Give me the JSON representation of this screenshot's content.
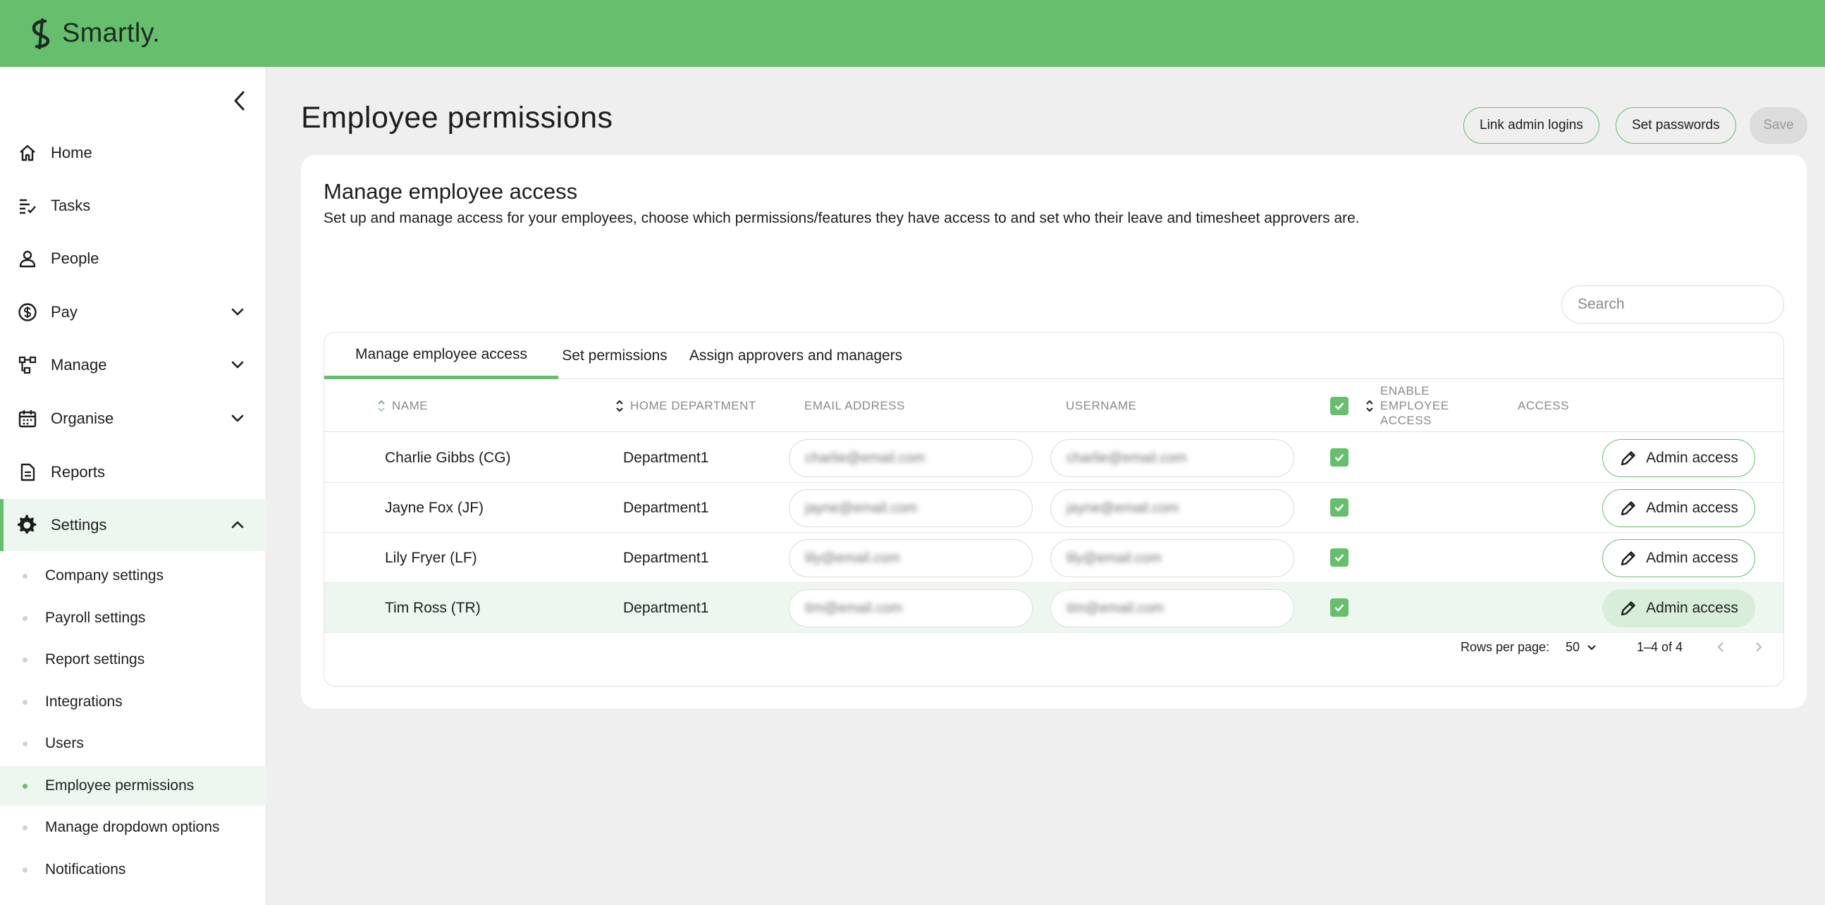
{
  "brand": {
    "name": "Smartly.",
    "accent": "#66bf6d"
  },
  "sidebar": {
    "items": [
      {
        "label": "Home",
        "icon": "home-icon"
      },
      {
        "label": "Tasks",
        "icon": "tasks-icon"
      },
      {
        "label": "People",
        "icon": "person-icon"
      },
      {
        "label": "Pay",
        "icon": "dollar-icon",
        "expandable": true
      },
      {
        "label": "Manage",
        "icon": "workflow-icon",
        "expandable": true
      },
      {
        "label": "Organise",
        "icon": "calendar-icon",
        "expandable": true
      },
      {
        "label": "Reports",
        "icon": "document-icon"
      },
      {
        "label": "Settings",
        "icon": "gear-icon",
        "expanded": true,
        "active": true
      }
    ],
    "settings_sub": [
      {
        "label": "Company settings"
      },
      {
        "label": "Payroll settings"
      },
      {
        "label": "Report settings"
      },
      {
        "label": "Integrations"
      },
      {
        "label": "Users"
      },
      {
        "label": "Employee permissions",
        "active": true
      },
      {
        "label": "Manage dropdown options"
      },
      {
        "label": "Notifications"
      }
    ]
  },
  "header": {
    "title": "Employee permissions",
    "buttons": {
      "link_admin": "Link admin logins",
      "set_passwords": "Set passwords",
      "save": "Save"
    }
  },
  "card": {
    "title": "Manage employee access",
    "description": "Set up and manage access for your employees, choose which permissions/features they have access to and set who their leave and timesheet approvers are.",
    "search_placeholder": "Search"
  },
  "tabs": [
    {
      "label": "Manage employee access",
      "active": true
    },
    {
      "label": "Set permissions"
    },
    {
      "label": "Assign approvers and managers"
    }
  ],
  "columns": {
    "name": "NAME",
    "home_department": "HOME DEPARTMENT",
    "email": "EMAIL ADDRESS",
    "username": "USERNAME",
    "enable_line1": "ENABLE",
    "enable_line2": "EMPLOYEE",
    "enable_line3": "ACCESS",
    "access": "ACCESS"
  },
  "rows": [
    {
      "name": "Charlie Gibbs (CG)",
      "department": "Department1",
      "email": "charlie@email.com",
      "username": "charlie@email.com",
      "enabled": true,
      "action": "Admin access"
    },
    {
      "name": "Jayne Fox (JF)",
      "department": "Department1",
      "email": "jayne@email.com",
      "username": "jayne@email.com",
      "enabled": true,
      "action": "Admin access"
    },
    {
      "name": "Lily Fryer (LF)",
      "department": "Department1",
      "email": "lily@email.com",
      "username": "lily@email.com",
      "enabled": true,
      "action": "Admin access"
    },
    {
      "name": "Tim Ross (TR)",
      "department": "Department1",
      "email": "tim@email.com",
      "username": "tim@email.com",
      "enabled": true,
      "action": "Admin access",
      "highlighted": true
    }
  ],
  "pagination": {
    "rows_per_page_label": "Rows per page:",
    "rows_per_page": "50",
    "range": "1–4 of 4"
  }
}
